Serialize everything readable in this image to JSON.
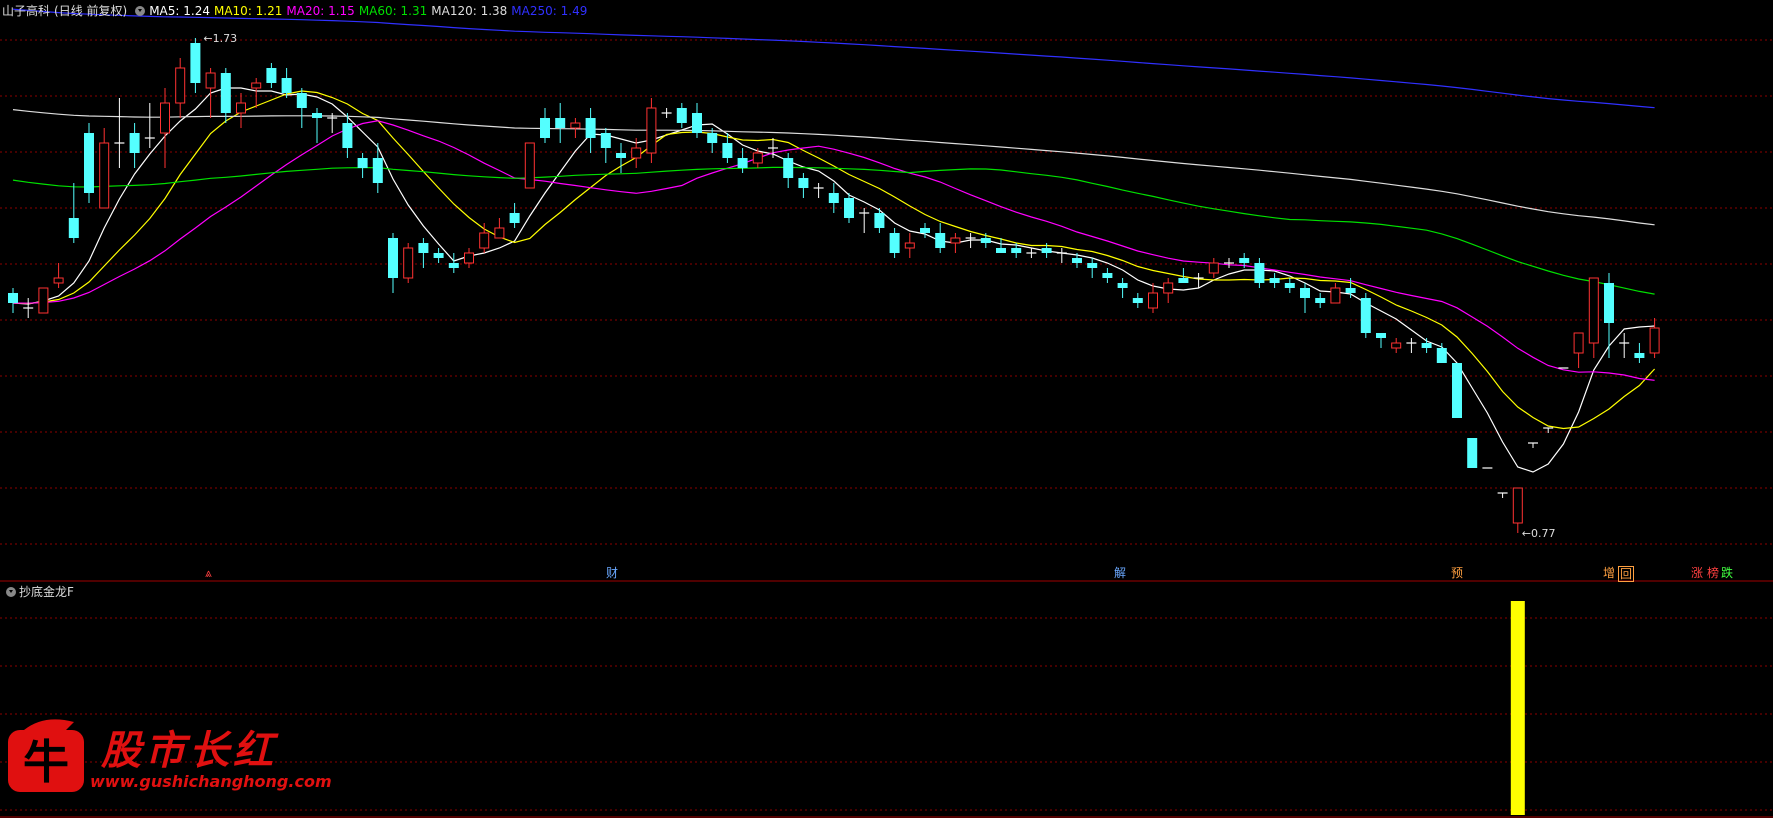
{
  "legend": {
    "stock": "山子高科",
    "period": "(日线 前复权)",
    "ma": [
      {
        "label": "MA5: 1.24",
        "color": "#ffffff"
      },
      {
        "label": "MA10: 1.21",
        "color": "#ffff00"
      },
      {
        "label": "MA20: 1.15",
        "color": "#ff00ff"
      },
      {
        "label": "MA60: 1.31",
        "color": "#00e000"
      },
      {
        "label": "MA120: 1.38",
        "color": "#dddddd"
      },
      {
        "label": "MA250: 1.49",
        "color": "#3030ff"
      }
    ]
  },
  "sub_indicator": {
    "title": "抄底金龙F",
    "bar_color": "#ffff00"
  },
  "events": [
    {
      "label": "⩓",
      "color": "#ff4040",
      "bg": ""
    },
    {
      "label": "财",
      "color": "#6aa8ff",
      "bg": ""
    },
    {
      "label": "解",
      "color": "#6aa8ff",
      "bg": ""
    },
    {
      "label": "预",
      "color": "#ffa040",
      "bg": ""
    },
    {
      "label": "增",
      "color": "#ffa040",
      "bg": ""
    },
    {
      "label": "回",
      "color": "#ffa040",
      "bg": "#ffa040"
    },
    {
      "label": "涨",
      "color": "#ff4040",
      "bg": ""
    },
    {
      "label": "榜",
      "color": "#ff4040",
      "bg": ""
    },
    {
      "label": "跌",
      "color": "#40ff40",
      "bg": ""
    }
  ],
  "watermark": {
    "title": "股市长红",
    "url": "www.gushichanghong.com",
    "logo_char": "牛"
  },
  "chart_data": {
    "type": "candlestick",
    "title": "山子高科 (日线 前复权)",
    "high_label": "1.73",
    "low_label": "0.77",
    "colors": {
      "up": "#ff3232",
      "down": "#54ffff",
      "flat": "#ffffff",
      "grid": "#8b0000",
      "border": "#a00000"
    },
    "y_range": [
      0.7,
      1.8
    ],
    "candles": [
      [
        1.25,
        1.26,
        1.21,
        1.23
      ],
      [
        1.22,
        1.24,
        1.2,
        1.22
      ],
      [
        1.21,
        1.26,
        1.21,
        1.26
      ],
      [
        1.27,
        1.31,
        1.26,
        1.28
      ],
      [
        1.4,
        1.47,
        1.35,
        1.36
      ],
      [
        1.57,
        1.59,
        1.43,
        1.45
      ],
      [
        1.42,
        1.58,
        1.42,
        1.55
      ],
      [
        1.55,
        1.64,
        1.5,
        1.55
      ],
      [
        1.57,
        1.59,
        1.5,
        1.53
      ],
      [
        1.56,
        1.63,
        1.54,
        1.56
      ],
      [
        1.57,
        1.66,
        1.5,
        1.63
      ],
      [
        1.63,
        1.72,
        1.6,
        1.7
      ],
      [
        1.75,
        1.76,
        1.65,
        1.67
      ],
      [
        1.66,
        1.7,
        1.6,
        1.69
      ],
      [
        1.69,
        1.7,
        1.59,
        1.61
      ],
      [
        1.61,
        1.65,
        1.58,
        1.63
      ],
      [
        1.66,
        1.68,
        1.62,
        1.67
      ],
      [
        1.7,
        1.71,
        1.66,
        1.67
      ],
      [
        1.68,
        1.7,
        1.64,
        1.65
      ],
      [
        1.65,
        1.66,
        1.58,
        1.62
      ],
      [
        1.61,
        1.62,
        1.55,
        1.6
      ],
      [
        1.6,
        1.61,
        1.57,
        1.6
      ],
      [
        1.59,
        1.61,
        1.52,
        1.54
      ],
      [
        1.52,
        1.53,
        1.48,
        1.5
      ],
      [
        1.52,
        1.55,
        1.45,
        1.47
      ],
      [
        1.36,
        1.37,
        1.25,
        1.28
      ],
      [
        1.28,
        1.35,
        1.27,
        1.34
      ],
      [
        1.35,
        1.36,
        1.3,
        1.33
      ],
      [
        1.33,
        1.34,
        1.31,
        1.32
      ],
      [
        1.31,
        1.33,
        1.29,
        1.3
      ],
      [
        1.31,
        1.34,
        1.3,
        1.33
      ],
      [
        1.34,
        1.39,
        1.33,
        1.37
      ],
      [
        1.36,
        1.4,
        1.36,
        1.38
      ],
      [
        1.41,
        1.43,
        1.38,
        1.39
      ],
      [
        1.46,
        1.55,
        1.46,
        1.55
      ],
      [
        1.6,
        1.62,
        1.55,
        1.56
      ],
      [
        1.6,
        1.63,
        1.55,
        1.58
      ],
      [
        1.58,
        1.6,
        1.56,
        1.59
      ],
      [
        1.6,
        1.62,
        1.53,
        1.56
      ],
      [
        1.57,
        1.58,
        1.51,
        1.54
      ],
      [
        1.53,
        1.55,
        1.49,
        1.52
      ],
      [
        1.52,
        1.56,
        1.5,
        1.54
      ],
      [
        1.53,
        1.64,
        1.51,
        1.62
      ],
      [
        1.61,
        1.62,
        1.6,
        1.61
      ],
      [
        1.62,
        1.63,
        1.58,
        1.59
      ],
      [
        1.61,
        1.63,
        1.56,
        1.57
      ],
      [
        1.57,
        1.58,
        1.53,
        1.55
      ],
      [
        1.55,
        1.57,
        1.51,
        1.52
      ],
      [
        1.52,
        1.54,
        1.49,
        1.5
      ],
      [
        1.51,
        1.54,
        1.5,
        1.53
      ],
      [
        1.54,
        1.56,
        1.52,
        1.54
      ],
      [
        1.52,
        1.53,
        1.46,
        1.48
      ],
      [
        1.48,
        1.49,
        1.44,
        1.46
      ],
      [
        1.46,
        1.47,
        1.44,
        1.46
      ],
      [
        1.45,
        1.47,
        1.41,
        1.43
      ],
      [
        1.44,
        1.45,
        1.39,
        1.4
      ],
      [
        1.41,
        1.42,
        1.37,
        1.41
      ],
      [
        1.41,
        1.42,
        1.37,
        1.38
      ],
      [
        1.37,
        1.38,
        1.32,
        1.33
      ],
      [
        1.34,
        1.37,
        1.32,
        1.35
      ],
      [
        1.38,
        1.39,
        1.36,
        1.37
      ],
      [
        1.37,
        1.39,
        1.33,
        1.34
      ],
      [
        1.35,
        1.37,
        1.33,
        1.36
      ],
      [
        1.36,
        1.37,
        1.34,
        1.36
      ],
      [
        1.36,
        1.37,
        1.34,
        1.35
      ],
      [
        1.34,
        1.36,
        1.33,
        1.33
      ],
      [
        1.34,
        1.35,
        1.32,
        1.33
      ],
      [
        1.33,
        1.34,
        1.32,
        1.33
      ],
      [
        1.34,
        1.35,
        1.32,
        1.33
      ],
      [
        1.33,
        1.34,
        1.31,
        1.33
      ],
      [
        1.32,
        1.33,
        1.3,
        1.31
      ],
      [
        1.31,
        1.32,
        1.28,
        1.3
      ],
      [
        1.29,
        1.3,
        1.27,
        1.28
      ],
      [
        1.27,
        1.28,
        1.24,
        1.26
      ],
      [
        1.24,
        1.25,
        1.22,
        1.23
      ],
      [
        1.22,
        1.27,
        1.21,
        1.25
      ],
      [
        1.25,
        1.28,
        1.23,
        1.27
      ],
      [
        1.28,
        1.3,
        1.27,
        1.27
      ],
      [
        1.28,
        1.29,
        1.26,
        1.28
      ],
      [
        1.29,
        1.32,
        1.28,
        1.31
      ],
      [
        1.31,
        1.32,
        1.3,
        1.31
      ],
      [
        1.32,
        1.33,
        1.3,
        1.31
      ],
      [
        1.31,
        1.32,
        1.26,
        1.27
      ],
      [
        1.28,
        1.29,
        1.26,
        1.27
      ],
      [
        1.27,
        1.28,
        1.25,
        1.26
      ],
      [
        1.26,
        1.27,
        1.21,
        1.24
      ],
      [
        1.24,
        1.25,
        1.22,
        1.23
      ],
      [
        1.23,
        1.27,
        1.23,
        1.26
      ],
      [
        1.26,
        1.28,
        1.24,
        1.25
      ],
      [
        1.24,
        1.25,
        1.16,
        1.17
      ],
      [
        1.17,
        1.17,
        1.14,
        1.16
      ],
      [
        1.14,
        1.16,
        1.13,
        1.15
      ],
      [
        1.15,
        1.16,
        1.13,
        1.15
      ],
      [
        1.15,
        1.16,
        1.13,
        1.14
      ],
      [
        1.14,
        1.15,
        1.11,
        1.11
      ],
      [
        1.11,
        1.11,
        1.0,
        1.0
      ],
      [
        0.96,
        0.96,
        0.9,
        0.9
      ],
      [
        0.9,
        0.9,
        0.9,
        0.9
      ],
      [
        0.85,
        0.85,
        0.84,
        0.85
      ],
      [
        0.79,
        0.86,
        0.77,
        0.86
      ],
      [
        0.95,
        0.95,
        0.94,
        0.95
      ],
      [
        0.98,
        0.98,
        0.97,
        0.98
      ],
      [
        1.1,
        1.1,
        1.1,
        1.1
      ],
      [
        1.13,
        1.17,
        1.1,
        1.17
      ],
      [
        1.15,
        1.28,
        1.12,
        1.28
      ],
      [
        1.27,
        1.29,
        1.12,
        1.19
      ],
      [
        1.15,
        1.17,
        1.12,
        1.15
      ],
      [
        1.13,
        1.15,
        1.11,
        1.12
      ],
      [
        1.13,
        1.2,
        1.12,
        1.18
      ]
    ],
    "sub_bars": [
      {
        "index": 99,
        "value": 1.0
      }
    ]
  }
}
